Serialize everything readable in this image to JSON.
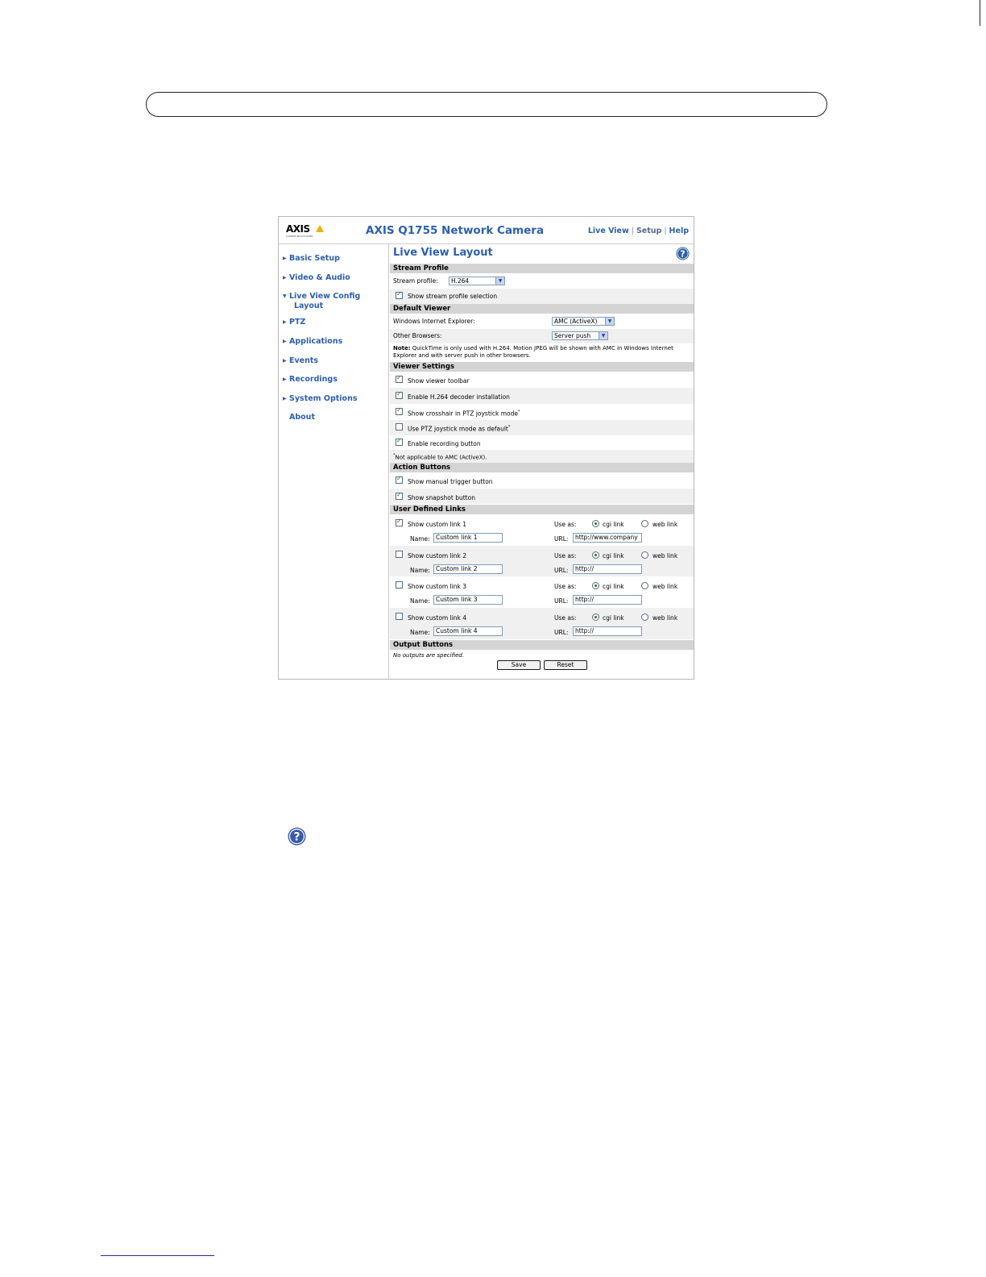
{
  "app": {
    "title": "AXIS Q1755 Network Camera",
    "logo_text": "AXIS",
    "logo_subtext": "COMMUNICATIONS",
    "topnav": {
      "live_view": "Live View",
      "setup": "Setup",
      "help": "Help"
    }
  },
  "sidebar": {
    "items": [
      {
        "label": "Basic Setup"
      },
      {
        "label": "Video & Audio"
      },
      {
        "label": "Live View Config",
        "sub": "Layout"
      },
      {
        "label": "PTZ"
      },
      {
        "label": "Applications"
      },
      {
        "label": "Events"
      },
      {
        "label": "Recordings"
      },
      {
        "label": "System Options"
      },
      {
        "label": "About"
      }
    ]
  },
  "main": {
    "title": "Live View Layout",
    "stream_profile": {
      "header": "Stream Profile",
      "label": "Stream profile:",
      "value": "H.264",
      "show_selection_label": "Show stream profile selection",
      "show_selection_checked": true
    },
    "default_viewer": {
      "header": "Default Viewer",
      "ie_label": "Windows Internet Explorer:",
      "ie_value": "AMC (ActiveX)",
      "other_label": "Other Browsers:",
      "other_value": "Server push",
      "note_bold": "Note:",
      "note_text": " QuickTime is only used with H.264. Motion JPEG will be shown with AMC in Windows Internet Explorer and with server push in other browsers."
    },
    "viewer_settings": {
      "header": "Viewer Settings",
      "items": [
        {
          "label": "Show viewer toolbar",
          "checked": true,
          "mark": ""
        },
        {
          "label": "Enable H.264 decoder installation",
          "checked": true,
          "mark": ""
        },
        {
          "label": "Show crosshair in PTZ joystick mode",
          "checked": true,
          "mark": "*"
        },
        {
          "label": "Use PTZ joystick mode as default",
          "checked": false,
          "mark": "*"
        },
        {
          "label": "Enable recording button",
          "checked": true,
          "mark": ""
        }
      ],
      "footnote_mark": "*",
      "footnote": "Not applicable to AMC (ActiveX)."
    },
    "action_buttons": {
      "header": "Action Buttons",
      "items": [
        {
          "label": "Show manual trigger button",
          "checked": true
        },
        {
          "label": "Show snapshot button",
          "checked": true
        }
      ]
    },
    "user_links": {
      "header": "User Defined Links",
      "use_as_label": "Use as:",
      "cgi_label": "cgi link",
      "web_label": "web link",
      "name_label": "Name:",
      "url_label": "URL:",
      "links": [
        {
          "label": "Show custom link 1",
          "checked": true,
          "use_as": "cgi",
          "name": "Custom link 1",
          "url": "http://www.company"
        },
        {
          "label": "Show custom link 2",
          "checked": false,
          "use_as": "cgi",
          "name": "Custom link 2",
          "url": "http://"
        },
        {
          "label": "Show custom link 3",
          "checked": false,
          "use_as": "cgi",
          "name": "Custom link 3",
          "url": "http://"
        },
        {
          "label": "Show custom link 4",
          "checked": false,
          "use_as": "cgi",
          "name": "Custom link 4",
          "url": "http://"
        }
      ]
    },
    "output_buttons": {
      "header": "Output Buttons",
      "text": "No outputs are specified."
    },
    "buttons": {
      "save": "Save",
      "reset": "Reset"
    }
  },
  "icons": {
    "help": "help-icon",
    "nav_arrow": "triangle-right-icon",
    "nav_arrow_open": "triangle-down-icon"
  },
  "colors": {
    "link_blue": "#2d5fad",
    "section_gray": "#d4d4d4",
    "check_green": "#1f7a1f"
  }
}
